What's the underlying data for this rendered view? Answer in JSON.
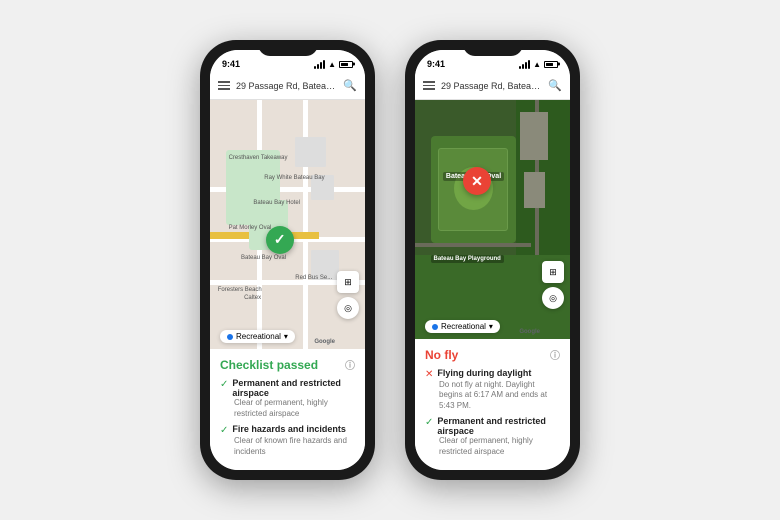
{
  "phones": [
    {
      "id": "phone-left",
      "status_bar": {
        "time": "9:41",
        "wifi": true,
        "battery": 70
      },
      "search_bar": {
        "text": "29 Passage Rd, Bateau Bay NSW...",
        "placeholder": "Search"
      },
      "map_type": "road",
      "pin_type": "green",
      "checklist": {
        "status": "passed",
        "title": "Checklist passed",
        "items": [
          {
            "icon": "check",
            "title": "Permanent and restricted airspace",
            "description": "Clear of permanent, highly restricted airspace"
          },
          {
            "icon": "check",
            "title": "Fire hazards and incidents",
            "description": "Clear of known fire hazards and incidents"
          }
        ]
      }
    },
    {
      "id": "phone-right",
      "status_bar": {
        "time": "9:41",
        "wifi": true,
        "battery": 70
      },
      "search_bar": {
        "text": "29 Passage Rd, Bateau Bay NSW...",
        "placeholder": "Search"
      },
      "map_type": "satellite",
      "pin_type": "red",
      "checklist": {
        "status": "no-fly",
        "title": "No fly",
        "items": [
          {
            "icon": "cross",
            "title": "Flying during daylight",
            "description": "Do not fly at night. Daylight begins at 6:17 AM and ends at 5:43 PM."
          },
          {
            "icon": "check",
            "title": "Permanent and restricted airspace",
            "description": "Clear of permanent, highly restricted airspace"
          }
        ]
      }
    }
  ],
  "category_chip": {
    "label": "Recreational",
    "chevron": "▾"
  },
  "google_label": "Google",
  "map_controls": {
    "layers": "⊞",
    "location": "◎"
  },
  "info_icon": "ⓘ",
  "bateau_bay_label": "Bateau Bay Oval",
  "bateau_playground_label": "Bateau Bay Playground"
}
